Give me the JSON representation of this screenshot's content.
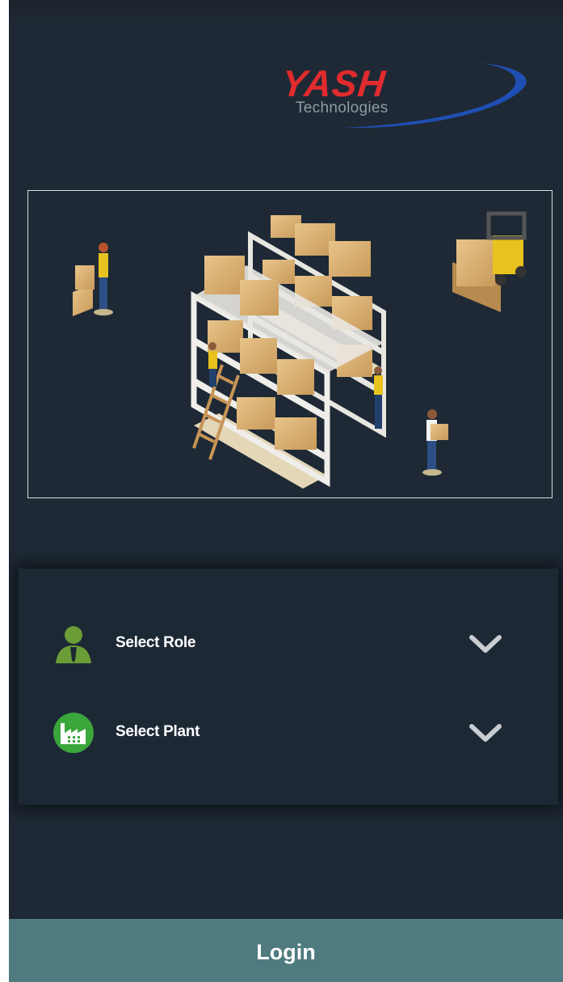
{
  "logo": {
    "brand": "YASH",
    "subtitle": "Technologies"
  },
  "illustration": {
    "icon": "warehouse-illustration"
  },
  "form": {
    "role": {
      "placeholder": "Select Role",
      "icon": "user-icon",
      "icon_color": "#6b9c37"
    },
    "plant": {
      "placeholder": "Select Plant",
      "icon": "factory-icon",
      "icon_color": "#3aa63c"
    }
  },
  "login": {
    "label": "Login"
  },
  "colors": {
    "background": "#1e2935",
    "login_button": "#4e7a80",
    "brand_red": "#e12b2e",
    "brand_blue": "#1f4fb4"
  }
}
